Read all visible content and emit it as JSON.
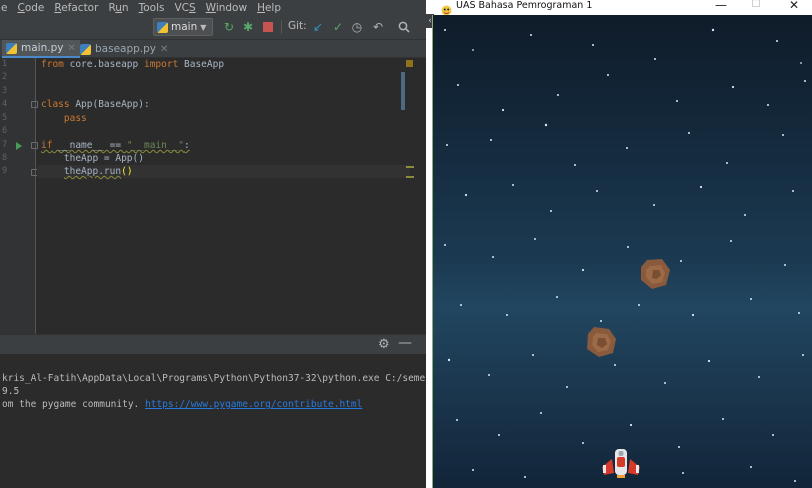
{
  "ide": {
    "menu": [
      {
        "label": "e",
        "underline_index": -1
      },
      {
        "label": "Code",
        "underline_index": 0
      },
      {
        "label": "Refactor",
        "underline_index": 0
      },
      {
        "label": "Run",
        "underline_index": 1
      },
      {
        "label": "Tools",
        "underline_index": 0
      },
      {
        "label": "VCS",
        "underline_index": 2
      },
      {
        "label": "Window",
        "underline_index": 0
      },
      {
        "label": "Help",
        "underline_index": 0
      }
    ],
    "toolbar": {
      "run_config": "main",
      "git_label": "Git:",
      "icons": [
        "rerun-icon",
        "debug-icon",
        "stop-icon",
        "vcs-update-icon",
        "vcs-commit-icon",
        "history-icon",
        "revert-icon",
        "search-icon"
      ]
    },
    "tabs": [
      {
        "label": "main.py",
        "active": true
      },
      {
        "label": "baseapp.py",
        "active": false
      }
    ],
    "gutter_lines": [
      "1",
      "2",
      "3",
      "4",
      "5",
      "6",
      "7",
      "8",
      "9"
    ],
    "terminal": {
      "line1": "kris_Al-Fatih\\AppData\\Local\\Programs\\Python\\Python37-32\\python.exe C:/semes",
      "line2": "9.5",
      "line3_prefix": "om the pygame community. ",
      "line3_link": "https://www.pygame.org/contribute.html"
    }
  },
  "game": {
    "window_title": "UAS Bahasa Pemrograman 1",
    "controls": {
      "minimize": "—",
      "maximize": "☐",
      "close": "✕"
    }
  },
  "colors": {
    "ide_bg": "#2b2b2b",
    "keyword": "#cc7832",
    "string": "#6a8759",
    "function": "#ffc66d",
    "link": "#287bde",
    "space_top": "#0f1c2a",
    "space_mid": "#224660",
    "asteroid": "#8a5a3c",
    "ship_red": "#d63a2a"
  }
}
